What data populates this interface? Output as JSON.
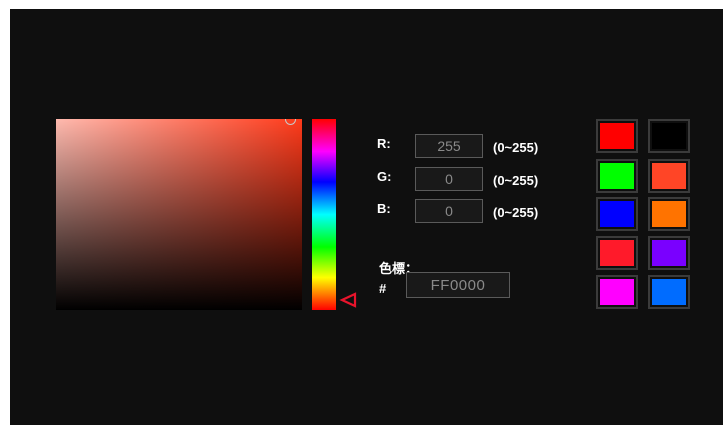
{
  "picker": {
    "base_color": "#ff3a1a"
  },
  "rgb": {
    "r": {
      "label": "R:",
      "value": "255",
      "range": "(0~255)"
    },
    "g": {
      "label": "G:",
      "value": "0",
      "range": "(0~255)"
    },
    "b": {
      "label": "B:",
      "value": "0",
      "range": "(0~255)"
    }
  },
  "hex": {
    "label": "色標：",
    "prefix": "#",
    "value": "FF0000"
  },
  "swatches": [
    {
      "name": "swatch-red",
      "color": "#ff0000"
    },
    {
      "name": "swatch-black",
      "color": "#000000"
    },
    {
      "name": "swatch-green",
      "color": "#00ff00"
    },
    {
      "name": "swatch-orange-red",
      "color": "#ff4526"
    },
    {
      "name": "swatch-blue",
      "color": "#0000ff"
    },
    {
      "name": "swatch-orange",
      "color": "#ff7300"
    },
    {
      "name": "swatch-crimson",
      "color": "#ff1a2a"
    },
    {
      "name": "swatch-violet",
      "color": "#7a00ff"
    },
    {
      "name": "swatch-magenta",
      "color": "#ff00ff"
    },
    {
      "name": "swatch-azure",
      "color": "#006cff"
    }
  ]
}
